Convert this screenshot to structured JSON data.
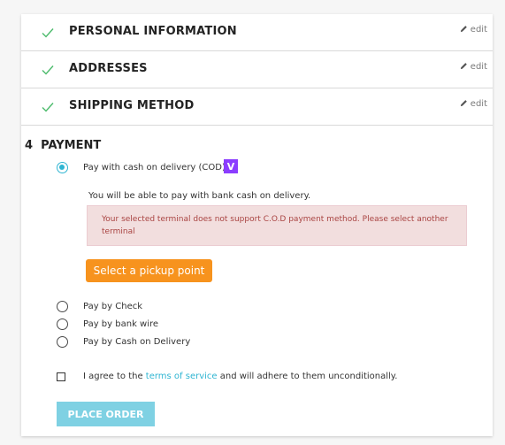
{
  "steps": [
    {
      "title": "PERSONAL INFORMATION",
      "edit": "edit"
    },
    {
      "title": "ADDRESSES",
      "edit": "edit"
    },
    {
      "title": "SHIPPING METHOD",
      "edit": "edit"
    }
  ],
  "payment": {
    "number": "4",
    "title": "PAYMENT",
    "selected_option": "Pay with cash on delivery (COD)",
    "logo_text": "V",
    "info_text": "You will be able to pay with bank cash on delivery.",
    "alert_text": "Your selected terminal does not support C.O.D payment method. Please select another terminal",
    "pickup_button": "Select a pickup point",
    "options": [
      "Pay by Check",
      "Pay by bank wire",
      "Pay by Cash on Delivery"
    ]
  },
  "terms": {
    "prefix": "I agree to the",
    "link": "terms of service",
    "suffix": "and will adhere to them unconditionally."
  },
  "place_order": "PLACE ORDER",
  "colors": {
    "accent": "#2fb5d2",
    "check_green": "#4cbb6c",
    "orange": "#f7931e",
    "alert_bg": "#f2dede",
    "alert_text": "#a94442",
    "logo_purple": "#8b3dff"
  }
}
